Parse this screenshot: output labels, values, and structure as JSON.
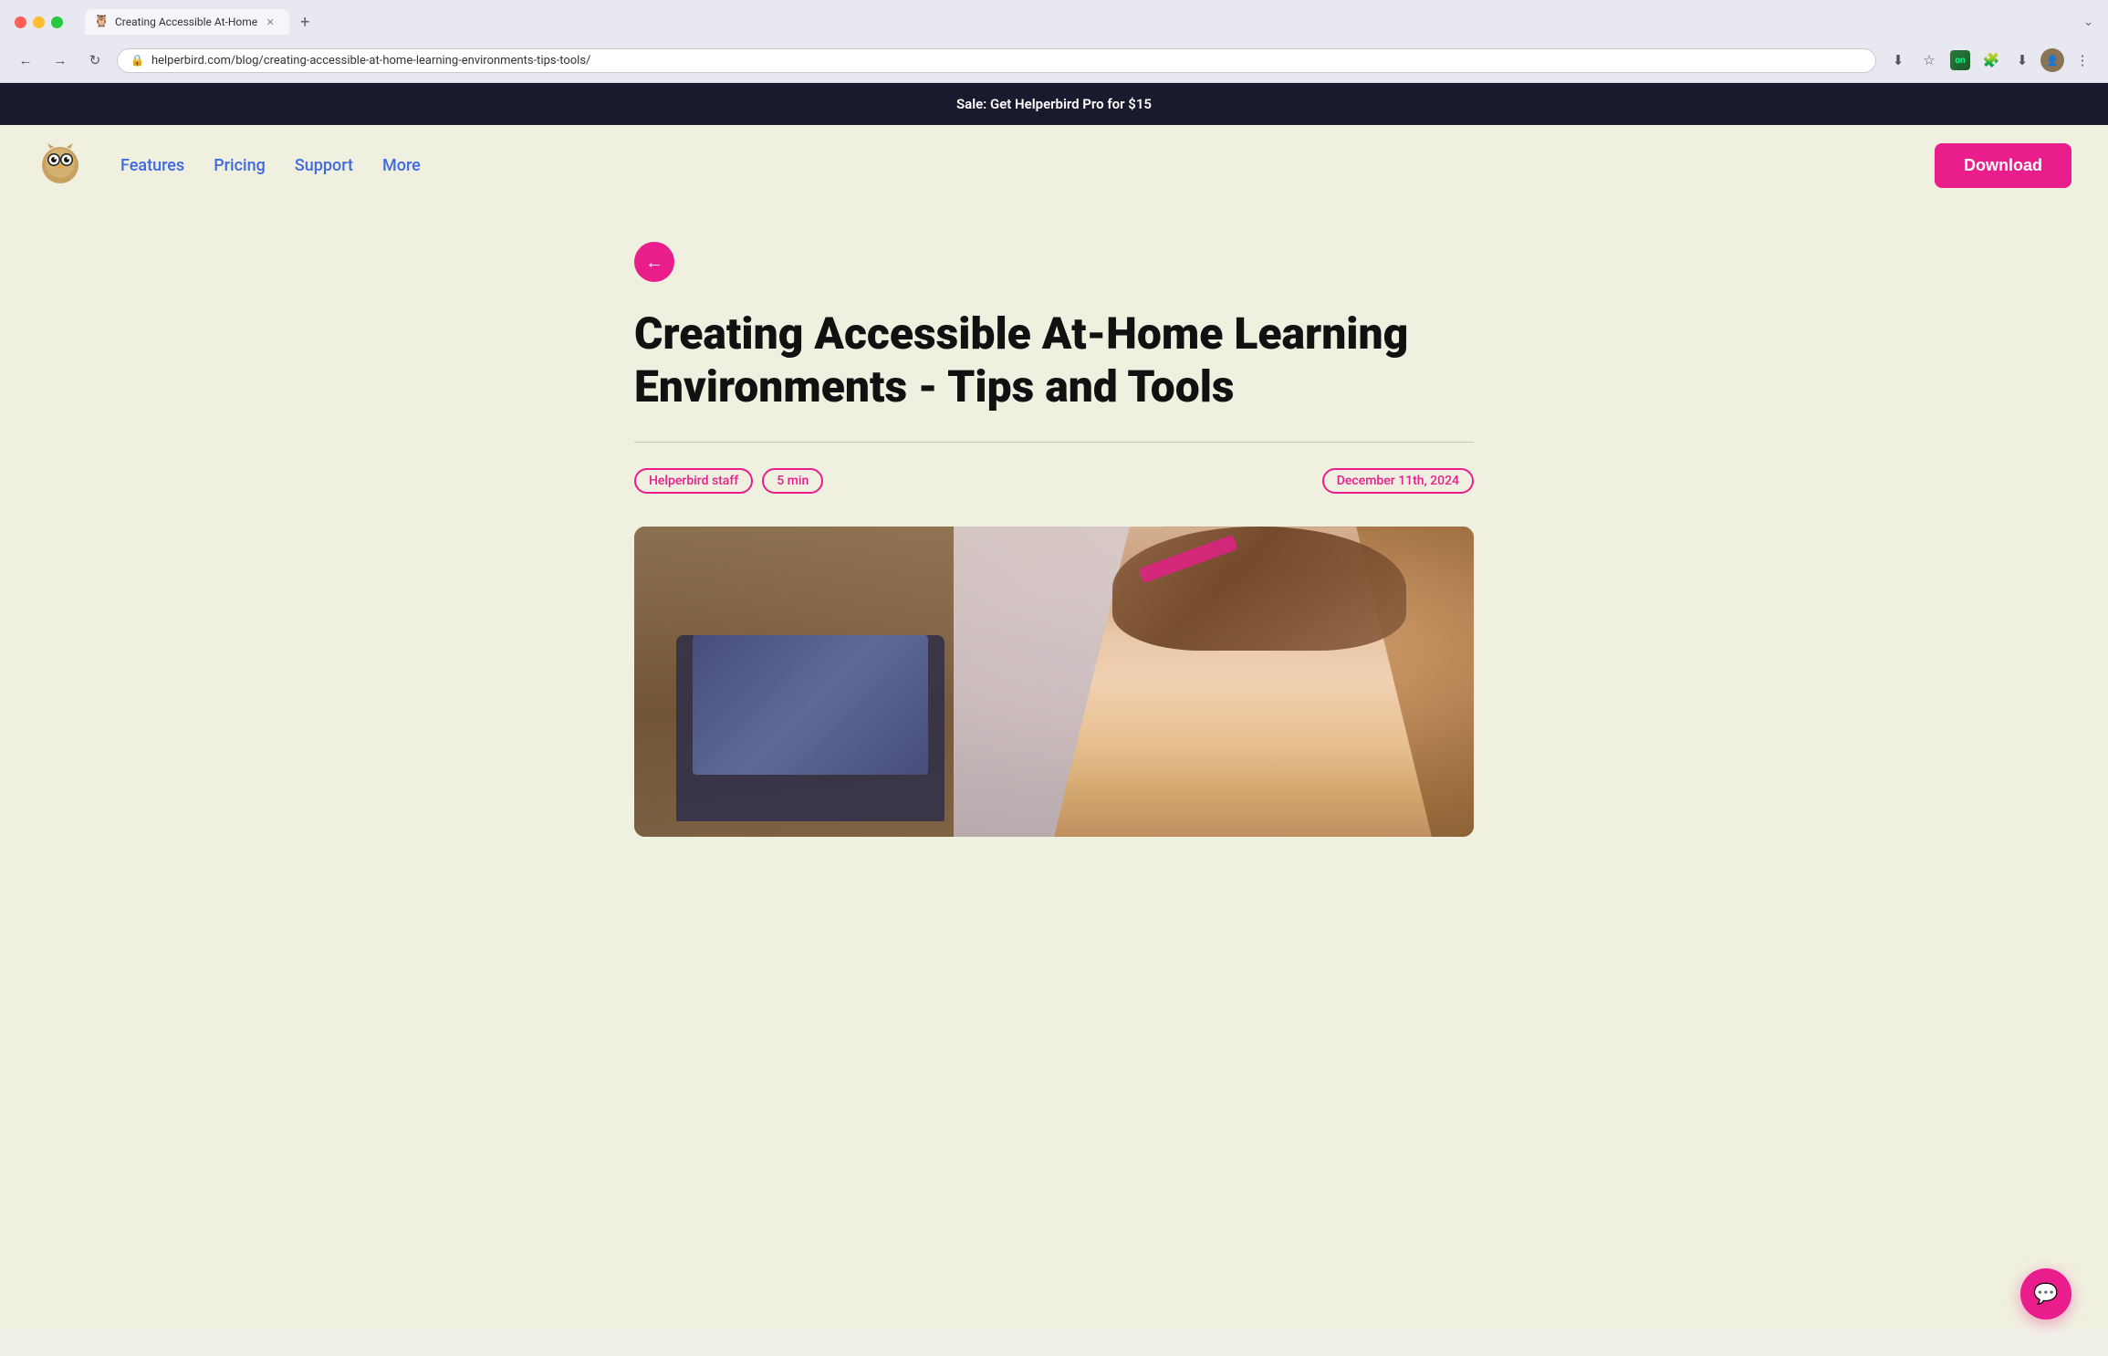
{
  "browser": {
    "tab": {
      "title": "Creating Accessible At-Home",
      "favicon": "🦉"
    },
    "url": "helperbird.com/blog/creating-accessible-at-home-learning-environments-tips-tools/",
    "new_tab_label": "+",
    "expand_label": "⌄"
  },
  "toolbar": {
    "back_icon": "←",
    "forward_icon": "→",
    "reload_icon": "↻",
    "address_icon": "🔒",
    "screenshot_icon": "⬇",
    "star_icon": "☆",
    "extensions_icon": "🧩",
    "download_icon": "⬇",
    "profile_icon": "👤",
    "menu_icon": "⋮"
  },
  "promo_banner": {
    "text": "Sale: Get Helperbird Pro for $15"
  },
  "nav": {
    "features_label": "Features",
    "pricing_label": "Pricing",
    "support_label": "Support",
    "more_label": "More",
    "download_label": "Download"
  },
  "article": {
    "back_icon": "←",
    "title": "Creating Accessible At-Home Learning Environments - Tips and Tools",
    "author": "Helperbird staff",
    "read_time": "5 min",
    "date": "December 11th, 2024"
  },
  "chat_widget": {
    "icon": "💬"
  }
}
